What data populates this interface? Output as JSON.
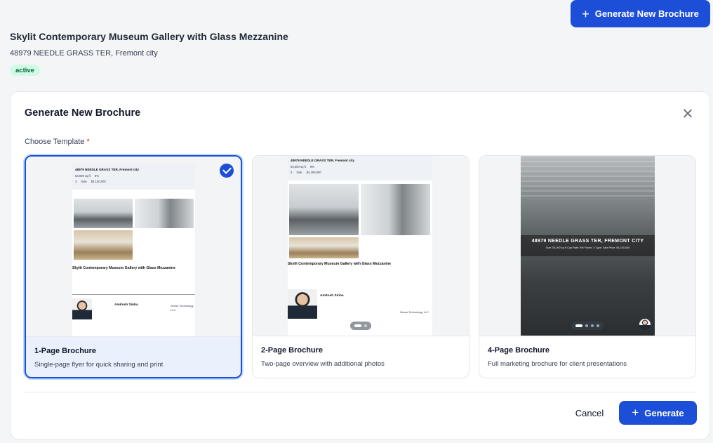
{
  "header": {
    "new_brochure_button": "Generate New Brochure",
    "property_title": "Skylit Contemporary Museum Gallery with Glass Mezzanine",
    "property_address": "48979 NEEDLE GRASS TER, Fremont city",
    "status_badge": "active"
  },
  "modal": {
    "title": "Generate New Brochure",
    "choose_label": "Choose Template",
    "required_marker": "*",
    "cancel_label": "Cancel",
    "generate_label": "Generate"
  },
  "templates": [
    {
      "name": "1-Page Brochure",
      "description": "Single-page flyer for quick sharing and print",
      "selected": true
    },
    {
      "name": "2-Page Brochure",
      "description": "Two-page overview with additional photos",
      "selected": false
    },
    {
      "name": "4-Page Brochure",
      "description": "Full marketing brochure for client presentations",
      "selected": false
    }
  ],
  "preview": {
    "address": "48979 NEEDLE GRASS TER, Fremont city",
    "address_upper": "48979 NEEDLE GRASS TER, FREMONT CITY",
    "size": "53,000 sq ft",
    "cap_rate": "8%",
    "floors": "3",
    "type": "Sale",
    "price": "$4,160,000",
    "listing_title": "Skylit Contemporary Museum Gallery with Glass Mezzanine",
    "agent_name": "Amitosh Sinha",
    "company": "Sense Technology LLC",
    "stats_line": "Size: 53,000 sq ft   Cap Rate: 8%   Floors: 3   Type: Sale   Price: $4,160,000"
  },
  "colors": {
    "primary": "#1d4ed8",
    "badge_bg": "#d1fae5",
    "badge_text": "#065f46"
  }
}
